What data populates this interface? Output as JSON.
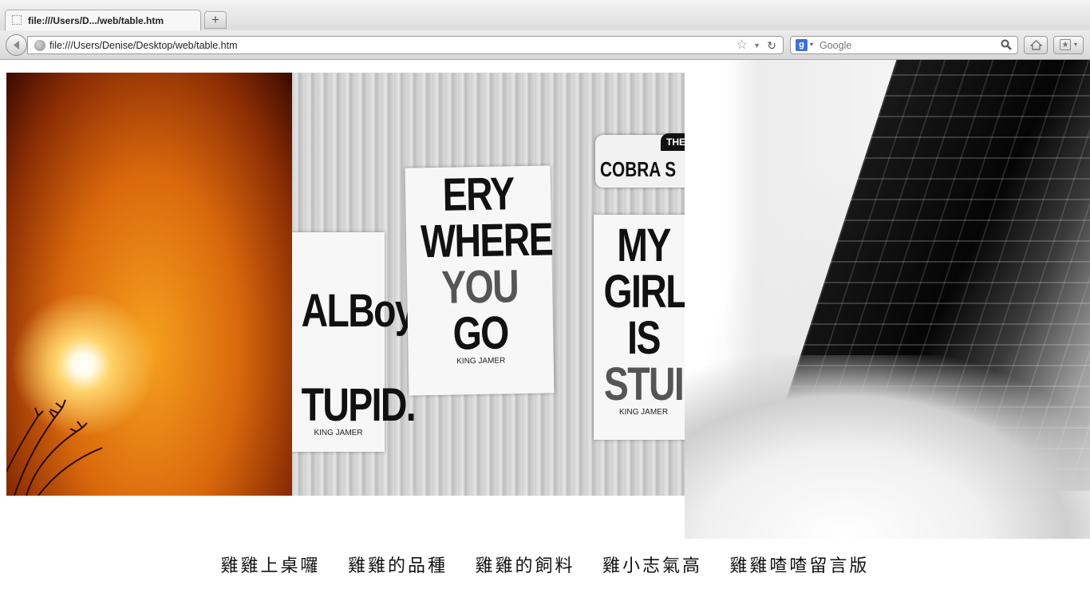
{
  "browser": {
    "tab_title": "file:///Users/D.../web/table.htm",
    "new_tab_label": "+",
    "url": "file:///Users/Denise/Desktop/web/table.htm",
    "search_engine_icon": "g",
    "search_placeholder": "Google"
  },
  "icons": {
    "back": "back-arrow-icon",
    "star": "☆",
    "dropdown": "▼",
    "reload": "↻",
    "search_caret": "▾",
    "bookmarks_caret": "▾",
    "bookmarks_star": "★"
  },
  "images": {
    "posters": {
      "poster_a_lines": [
        "ALBoy",
        "TUPID."
      ],
      "poster_a_credit": "KING JAMER",
      "poster_b_lines": [
        "ERY",
        "WHERE",
        "YOU",
        "GO"
      ],
      "poster_b_credit": "KING JAMER",
      "poster_c_lines": [
        "MY",
        "GIRL",
        "IS",
        "STUI"
      ],
      "poster_c_credit": "KING JAMER",
      "sign_top": "THE",
      "sign_text": "COBRA S"
    }
  },
  "nav": {
    "items": [
      {
        "label": "雞雞上桌囉"
      },
      {
        "label": "雞雞的品種"
      },
      {
        "label": "雞雞的飼料"
      },
      {
        "label": "雞小志氣高"
      },
      {
        "label": "雞雞喳喳留言版"
      }
    ]
  }
}
